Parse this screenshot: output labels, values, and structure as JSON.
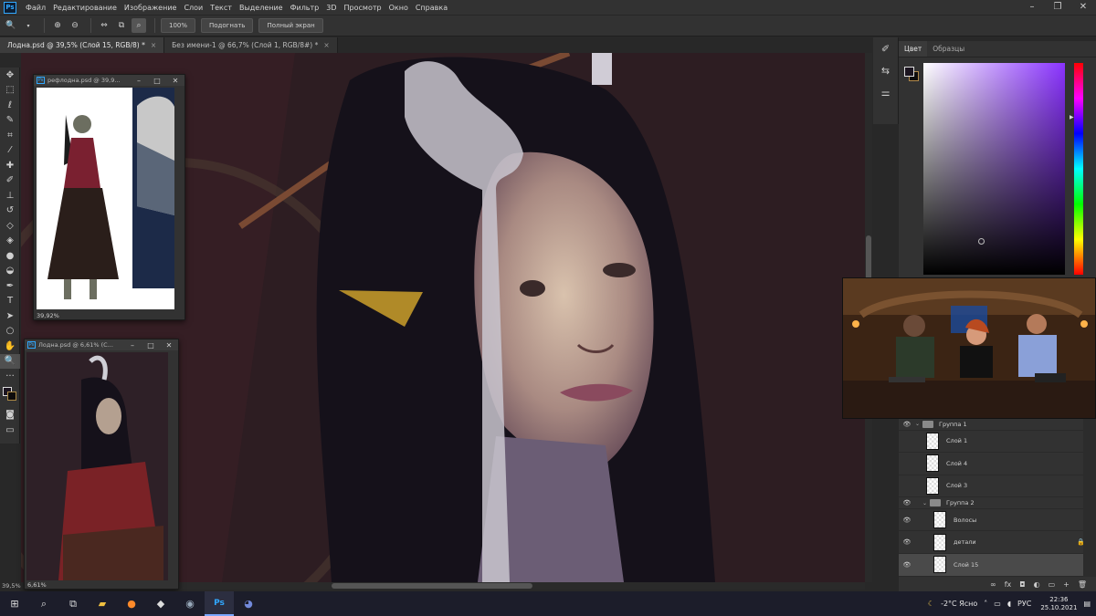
{
  "menu": {
    "logo": "Ps",
    "items": [
      "Файл",
      "Редактирование",
      "Изображение",
      "Слои",
      "Текст",
      "Выделение",
      "Фильтр",
      "3D",
      "Просмотр",
      "Окно",
      "Справка"
    ]
  },
  "options": {
    "zoom_value": "100%",
    "fit_button": "Подогнать",
    "fullscreen_button": "Полный экран"
  },
  "tabs": [
    {
      "label": "Лодна.psd @ 39,5% (Слой 15, RGB/8) *",
      "close": "×"
    },
    {
      "label": "Без имени-1 @ 66,7% (Слой 1, RGB/8#) *",
      "close": "×"
    }
  ],
  "float1": {
    "title": "рефлодна.psd @ 39,9...",
    "zoom": "39,92%"
  },
  "float2": {
    "title": "Лодна.psd @ 6,61% (С...",
    "zoom": "6,61%"
  },
  "status": {
    "zoom": "39,5%"
  },
  "color_panel": {
    "tabs": [
      "Цвет",
      "Образцы"
    ],
    "fg_color": "#1c1520",
    "bg_color": "#0e0c0c"
  },
  "layers": [
    {
      "name": "Группа 1",
      "type": "group",
      "visible": true,
      "indent": 0
    },
    {
      "name": "Слой 1",
      "type": "layer",
      "visible": false,
      "indent": 1
    },
    {
      "name": "Слой 4",
      "type": "layer",
      "visible": false,
      "indent": 1
    },
    {
      "name": "Слой 3",
      "type": "layer",
      "visible": false,
      "indent": 1
    },
    {
      "name": "Группа 2",
      "type": "group",
      "visible": true,
      "indent": 1
    },
    {
      "name": "Волосы",
      "type": "layer",
      "visible": true,
      "indent": 2
    },
    {
      "name": "детали",
      "type": "layer",
      "visible": true,
      "indent": 2,
      "locked": true
    },
    {
      "name": "Слой 15",
      "type": "layer",
      "visible": true,
      "indent": 2,
      "selected": true
    }
  ],
  "layers_footer": [
    "∞",
    "fx",
    "◘",
    "◐",
    "▭",
    "+",
    "🗑"
  ],
  "taskbar": {
    "tray_weather": "-2°C Ясно",
    "lang": "РУС",
    "time": "22:36",
    "date": "25.10.2021"
  }
}
